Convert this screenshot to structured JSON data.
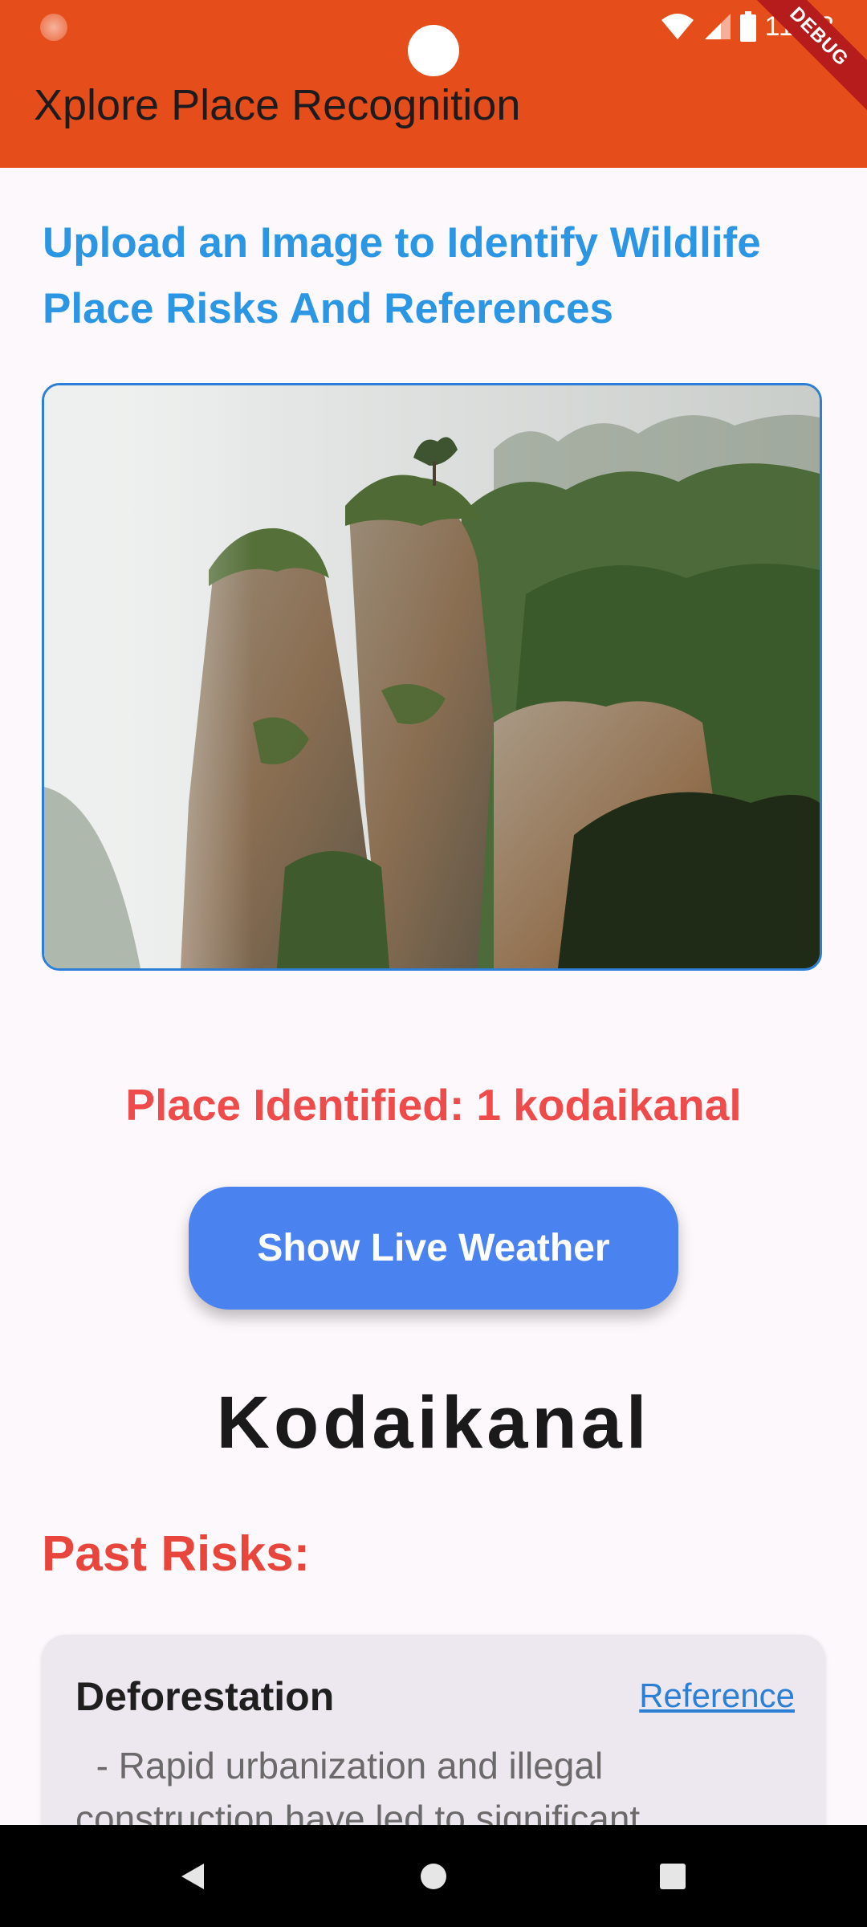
{
  "status_bar": {
    "time": "11:33",
    "debug_label": "DEBUG",
    "icons": [
      "app-notification-icon",
      "wifi-icon",
      "signal-icon",
      "battery-icon"
    ]
  },
  "app_bar": {
    "title": "Xplore Place Recognition",
    "background_color": "#e54e1b"
  },
  "main": {
    "headline": "Upload an Image to Identify Wildlife Place Risks And References",
    "uploaded_image": "cliff-rock-pillars-photo",
    "place_identified": "Place Identified: 1 kodaikanal",
    "weather_button_label": "Show Live Weather",
    "city_name": "Kodaikanal",
    "past_risks_heading": "Past Risks:",
    "risks": [
      {
        "title": "Deforestation",
        "reference_label": "Reference",
        "description": "  - Rapid urbanization and illegal construction have led to significant"
      }
    ]
  },
  "colors": {
    "headline": "#2b96e3",
    "place_identified": "#ef4b4b",
    "button": "#4a82f0",
    "past_risks": "#e8453c",
    "link": "#2b80d6"
  },
  "nav_bar": {
    "icons": [
      "back-icon",
      "home-icon",
      "recents-icon"
    ]
  }
}
